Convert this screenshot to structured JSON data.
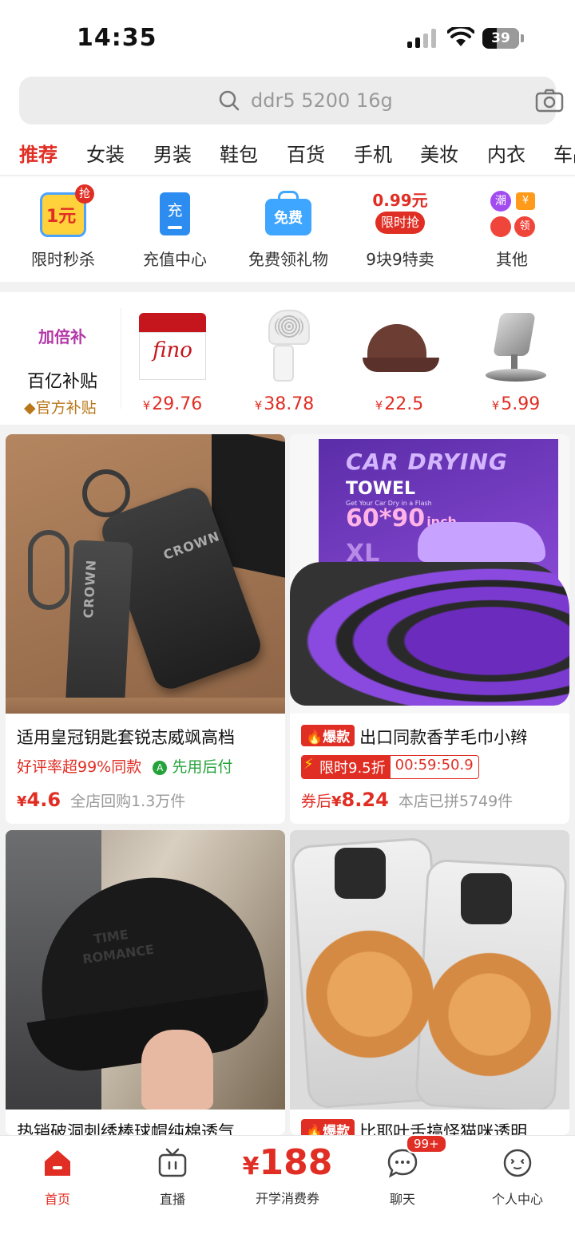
{
  "status_bar": {
    "time": "14:35",
    "battery": "39"
  },
  "search": {
    "placeholder": "ddr5 5200 16g",
    "icon": "search-icon",
    "camera_icon": "camera-icon"
  },
  "categories": [
    "推荐",
    "女装",
    "男装",
    "鞋包",
    "百货",
    "手机",
    "美妆",
    "内衣",
    "车品"
  ],
  "active_category": "推荐",
  "shortcuts": [
    {
      "label": "限时秒杀",
      "badge_main": "1元",
      "badge_corner": "抢",
      "icon": "flash-sale-icon"
    },
    {
      "label": "充值中心",
      "badge_main": "充",
      "icon": "recharge-icon"
    },
    {
      "label": "免费领礼物",
      "badge_main": "免费",
      "icon": "free-gift-icon"
    },
    {
      "label": "9块9特卖",
      "badge_top": "0.99元",
      "badge_main": "限时抢",
      "icon": "special-sale-icon"
    },
    {
      "label": "其他",
      "badges": [
        "潮",
        "¥",
        "领"
      ],
      "icon": "other-icon"
    }
  ],
  "subsidy": {
    "brand": "加倍补",
    "title": "百亿补贴",
    "tag": "官方补贴",
    "items": [
      {
        "price": "29.76",
        "icon": "hair-mask-icon",
        "brand_text": "fino"
      },
      {
        "price": "38.78",
        "icon": "lint-remover-icon"
      },
      {
        "price": "22.5",
        "icon": "cap-icon"
      },
      {
        "price": "5.99",
        "icon": "phone-stand-icon"
      }
    ],
    "currency": "¥"
  },
  "products": [
    {
      "title": "适用皇冠钥匙套锐志威飒高档",
      "line2_red": "好评率超99%同款",
      "line2_green": "先用后付",
      "price": "4.6",
      "currency": "¥",
      "sales": "全店回购1.3万件",
      "image_text": [
        "CROWN",
        "CROWN"
      ]
    },
    {
      "hot_badge": "爆款",
      "title": "出口同款香芋毛巾小辫",
      "deal_label": "限时9.5折",
      "deal_timer": "00:59:50.9",
      "price_prefix": "券后",
      "currency": "¥",
      "price": "8.24",
      "sales": "本店已拼5749件",
      "image_text": [
        "CAR DRYING",
        "TOWEL",
        "Get Your Car Dry in a Flash",
        "60*90",
        "inch",
        "XL"
      ]
    },
    {
      "title": "热销破洞刺绣棒球帽纯棉透气",
      "image_text": [
        "TIME",
        "ROMANCE"
      ]
    },
    {
      "hot_badge": "爆款",
      "title": "比耶叶舌搞怪猫咪透明"
    }
  ],
  "tabbar": {
    "home": "首页",
    "live": "直播",
    "coupon_amount": "188",
    "coupon_currency": "¥",
    "coupon_label": "开学消费券",
    "chat": "聊天",
    "chat_badge": "99+",
    "profile": "个人中心"
  },
  "colors": {
    "accent": "#e02e24",
    "green": "#25a33a",
    "gold": "#b9771a"
  }
}
